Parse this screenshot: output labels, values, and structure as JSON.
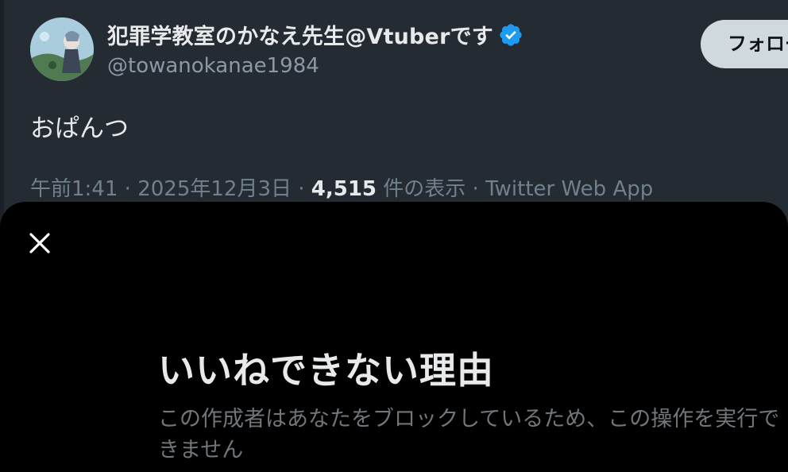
{
  "tweet": {
    "display_name": "犯罪学教室のかなえ先生@Vtuberです",
    "handle": "@towanokanae1984",
    "follow_label": "フォロー",
    "text": "おぱんつ",
    "meta": {
      "time": "午前1:41",
      "separator": " · ",
      "date": "2025年12月3日",
      "views_count": "4,515",
      "views_label": " 件の表示",
      "source": "Twitter Web App"
    }
  },
  "sheet": {
    "title": "いいねできない理由",
    "description": "この作成者はあなたをブロックしているため、この操作を実行できません"
  },
  "icons": {
    "verified": "verified-badge-icon",
    "close": "close-icon"
  },
  "colors": {
    "background": "#252b33",
    "sheet_background": "#000000",
    "verified_blue": "#1d9bf0",
    "primary_text": "#e7e9ea",
    "secondary_text": "#71808d",
    "follow_button": "#cfd9de"
  }
}
